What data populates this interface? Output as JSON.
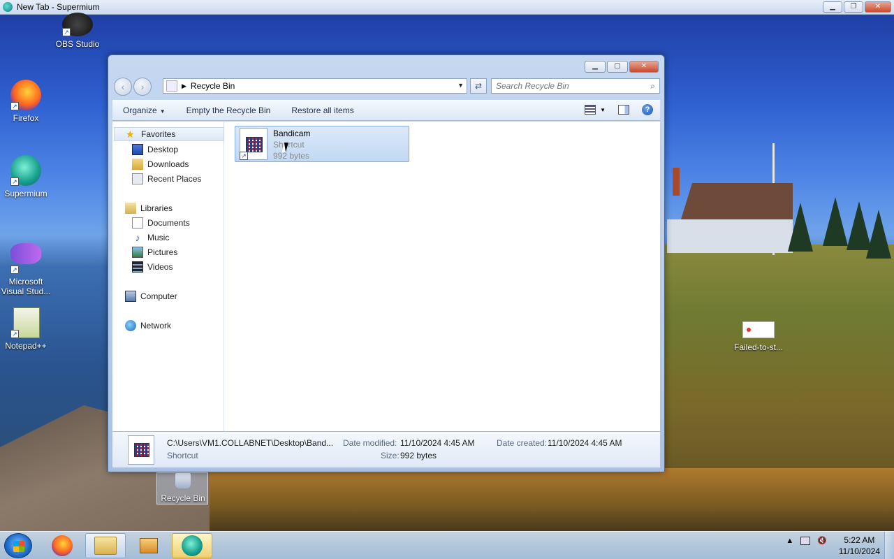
{
  "app_window": {
    "title": "New Tab - Supermium",
    "controls": [
      "minimize",
      "maximize",
      "close"
    ]
  },
  "desktop": {
    "icons": [
      {
        "label": "OBS Studio"
      },
      {
        "label": "Firefox"
      },
      {
        "label": "Supermium"
      },
      {
        "label": "Microsoft Visual Stud..."
      },
      {
        "label": "Notepad++"
      },
      {
        "label": "Failed-to-st..."
      },
      {
        "label": "Recycle Bin"
      }
    ]
  },
  "explorer": {
    "address": {
      "path": "Recycle Bin"
    },
    "search": {
      "placeholder": "Search Recycle Bin"
    },
    "toolbar": {
      "organize": "Organize",
      "empty": "Empty the Recycle Bin",
      "restore": "Restore all items"
    },
    "nav": {
      "favorites": "Favorites",
      "desktop": "Desktop",
      "downloads": "Downloads",
      "recent": "Recent Places",
      "libraries": "Libraries",
      "documents": "Documents",
      "music": "Music",
      "pictures": "Pictures",
      "videos": "Videos",
      "computer": "Computer",
      "network": "Network"
    },
    "items": [
      {
        "name": "Bandicam",
        "type": "Shortcut",
        "size": "992 bytes"
      }
    ],
    "details": {
      "path": "C:\\Users\\VM1.COLLABNET\\Desktop\\Band...",
      "type": "Shortcut",
      "date_modified_label": "Date modified:",
      "date_modified": "11/10/2024 4:45 AM",
      "date_created_label": "Date created:",
      "date_created": "11/10/2024 4:45 AM",
      "size_label": "Size:",
      "size": "992 bytes"
    }
  },
  "taskbar": {
    "clock_time": "5:22 AM",
    "clock_date": "11/10/2024"
  },
  "colors": {
    "accent": "#1e55b8",
    "selection": "#c2d8f3",
    "taskbar": "#c8dcf0"
  }
}
